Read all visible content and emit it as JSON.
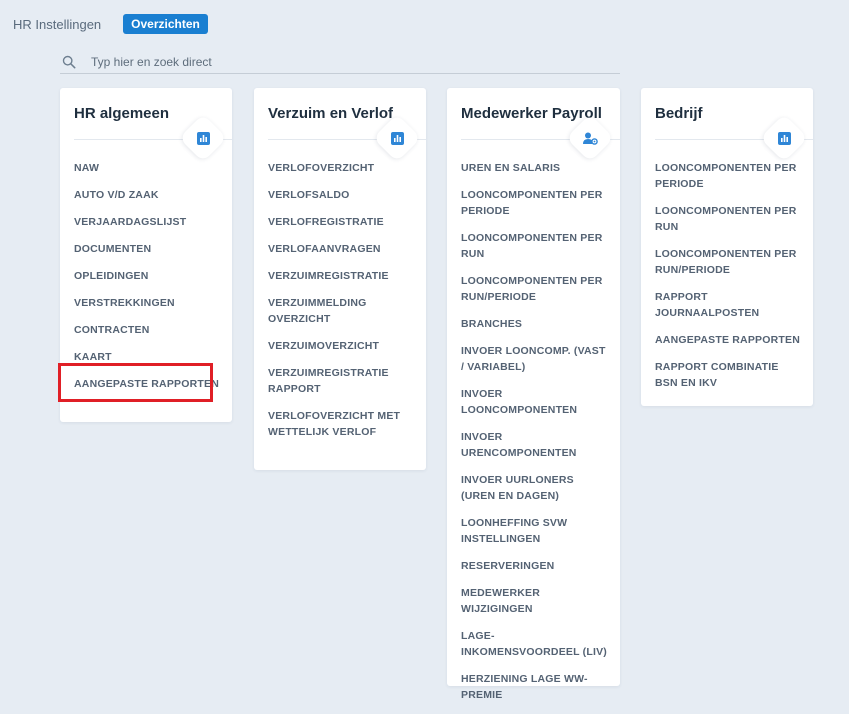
{
  "nav": {
    "tabs": [
      {
        "label": "HR Instellingen"
      },
      {
        "label": "Overzichten"
      }
    ]
  },
  "search": {
    "placeholder": "Typ hier en zoek direct",
    "value": ""
  },
  "accent_color": "#1a7fd1",
  "highlight_color": "#e01f26",
  "cards": [
    {
      "title": "HR algemeen",
      "icon": "bar-chart-icon",
      "items": [
        "NAW",
        "AUTO V/D ZAAK",
        "VERJAARDAGSLIJST",
        "DOCUMENTEN",
        "OPLEIDINGEN",
        "VERSTREKKINGEN",
        "CONTRACTEN",
        "KAART",
        "AANGEPASTE RAPPORTEN"
      ]
    },
    {
      "title": "Verzuim en Verlof",
      "icon": "bar-chart-icon",
      "items": [
        "VERLOFOVERZICHT",
        "VERLOFSALDO",
        "VERLOFREGISTRATIE",
        "VERLOFAANVRAGEN",
        "VERZUIMREGISTRATIE",
        "VERZUIMMELDING OVERZICHT",
        "VERZUIMOVERZICHT",
        "VERZUIMREGISTRATIE RAPPORT",
        "VERLOFOVERZICHT MET WETTELIJK VERLOF"
      ]
    },
    {
      "title": "Medewerker Payroll",
      "icon": "user-settings-icon",
      "items": [
        "UREN EN SALARIS",
        "LOONCOMPONENTEN PER PERIODE",
        "LOONCOMPONENTEN PER RUN",
        "LOONCOMPONENTEN PER RUN/PERIODE",
        "BRANCHES",
        "INVOER LOONCOMP. (VAST / VARIABEL)",
        "INVOER LOONCOMPONENTEN",
        "INVOER URENCOMPONENTEN",
        "INVOER UURLONERS (UREN EN DAGEN)",
        "LOONHEFFING SVW INSTELLINGEN",
        "RESERVERINGEN",
        "MEDEWERKER WIJZIGINGEN",
        "LAGE-INKOMENSVOORDEEL (LIV)",
        "HERZIENING LAGE WW-PREMIE"
      ]
    },
    {
      "title": "Bedrijf",
      "icon": "bar-chart-icon",
      "items": [
        "LOONCOMPONENTEN PER PERIODE",
        "LOONCOMPONENTEN PER RUN",
        "LOONCOMPONENTEN PER RUN/PERIODE",
        "RAPPORT JOURNAALPOSTEN",
        "AANGEPASTE RAPPORTEN",
        "RAPPORT COMBINATIE BSN EN IKV"
      ]
    }
  ]
}
